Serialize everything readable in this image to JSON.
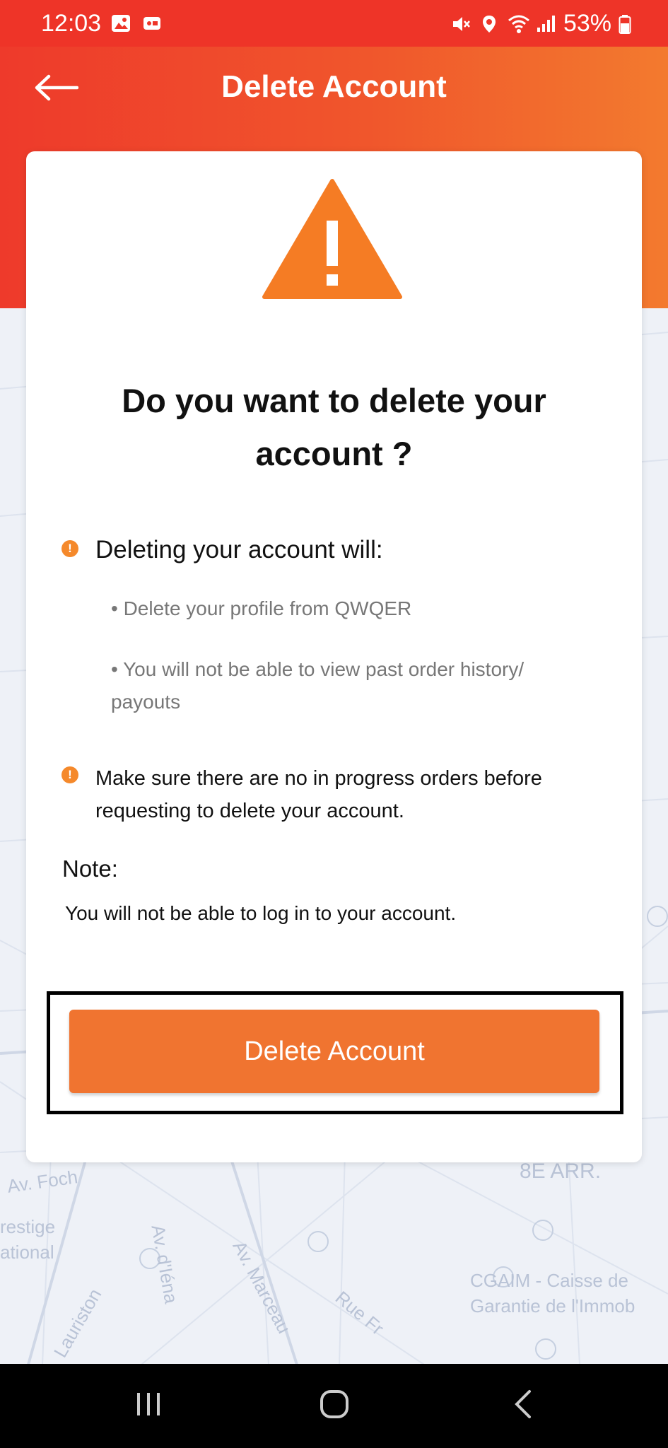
{
  "status_bar": {
    "time": "12:03",
    "battery": "53%"
  },
  "header": {
    "title": "Delete Account"
  },
  "dialog": {
    "question_line1": "Do you want to delete your",
    "question_line2": "account ?",
    "deleting_heading": "Deleting your account will:",
    "bullets": [
      "• Delete your profile from QWQER",
      "• You will not be able to view past order history/",
      "payouts"
    ],
    "progress_line1": "Make sure there are no in progress orders before",
    "progress_line2": "requesting to delete your account.",
    "note_label": "Note:",
    "note_text": "You will not be able to log in to your account.",
    "button_label": "Delete Account"
  },
  "map_labels": {
    "l1": "Av. Foch",
    "l2": "restige",
    "l3": "ational",
    "l4": "Av. d'Iéna",
    "l5": "Av. Marceau",
    "l6": "Rue Fr",
    "l7": "CGAIM - Caisse de",
    "l8": "Garantie de l'Immob",
    "l9": "8E ARR.",
    "l10": "Lauriston"
  },
  "colors": {
    "header_start": "#ee3a2b",
    "header_end": "#f37a2e",
    "accent": "#f07430",
    "warning": "#f5892b"
  },
  "icons": {
    "back": "arrow-left-icon",
    "warning": "warning-triangle-icon",
    "info": "exclamation-circle-icon"
  }
}
